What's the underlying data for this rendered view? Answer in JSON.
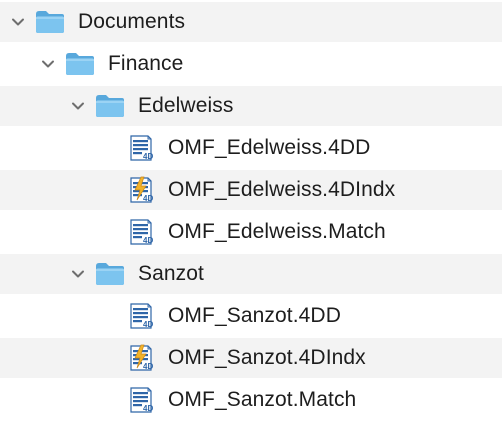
{
  "tree": {
    "root": {
      "label": "Documents",
      "icon": "folder-icon",
      "expanded": true
    },
    "finance": {
      "label": "Finance",
      "icon": "folder-icon",
      "expanded": true
    },
    "edelweiss": {
      "label": "Edelweiss",
      "icon": "folder-icon",
      "expanded": true,
      "files": [
        {
          "label": "OMF_Edelweiss.4DD",
          "icon": "4d-data-file-icon"
        },
        {
          "label": "OMF_Edelweiss.4DIndx",
          "icon": "4d-index-file-icon"
        },
        {
          "label": "OMF_Edelweiss.Match",
          "icon": "4d-data-file-icon"
        }
      ]
    },
    "sanzot": {
      "label": "Sanzot",
      "icon": "folder-icon",
      "expanded": true,
      "files": [
        {
          "label": "OMF_Sanzot.4DD",
          "icon": "4d-data-file-icon"
        },
        {
          "label": "OMF_Sanzot.4DIndx",
          "icon": "4d-index-file-icon"
        },
        {
          "label": "OMF_Sanzot.Match",
          "icon": "4d-data-file-icon"
        }
      ]
    }
  },
  "colors": {
    "folder": "#6fbcec",
    "folder_tab": "#58a8dc",
    "row_alt": "#f3f3f3",
    "text": "#1d1d1d",
    "chevron": "#6e6e6e",
    "doc_blue": "#2f66a8",
    "bolt": "#f2b32a"
  }
}
